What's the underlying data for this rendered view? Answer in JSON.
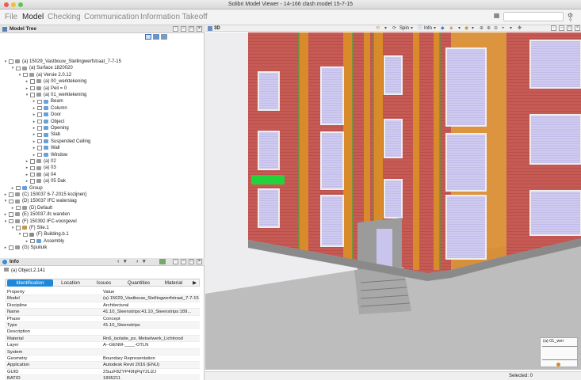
{
  "window": {
    "title": "Solibri Model Viewer - 14-166 clash model 15-7-15"
  },
  "menu": [
    "File",
    "Model",
    "Checking",
    "Communication",
    "Information Takeoff"
  ],
  "menu_active": "Model",
  "model_tree": {
    "title": "Model Tree",
    "rows": [
      {
        "label": "(a) 15029_Vastbouw_Stellingwerfstraat_7-7-15",
        "indent": 0,
        "tw": "▾",
        "icon": "box"
      },
      {
        "label": "(a) Surface 1820020",
        "indent": 1,
        "tw": "▾",
        "icon": "box"
      },
      {
        "label": "(a) Versie 2.0.12",
        "indent": 2,
        "tw": "▾",
        "icon": "box"
      },
      {
        "label": "(a) 00_werktekening",
        "indent": 3,
        "tw": "▸",
        "icon": "box"
      },
      {
        "label": "(a) Peil = 0",
        "indent": 3,
        "tw": "▸",
        "icon": "box"
      },
      {
        "label": "(a) 01_werktekening",
        "indent": 3,
        "tw": "▾",
        "icon": "box"
      },
      {
        "label": "Beam",
        "indent": 4,
        "tw": "▸",
        "icon": "folder"
      },
      {
        "label": "Column",
        "indent": 4,
        "tw": "▸",
        "icon": "folder"
      },
      {
        "label": "Door",
        "indent": 4,
        "tw": "▸",
        "icon": "folder"
      },
      {
        "label": "Object",
        "indent": 4,
        "tw": "▸",
        "icon": "folder"
      },
      {
        "label": "Opening",
        "indent": 4,
        "tw": "▸",
        "icon": "folder"
      },
      {
        "label": "Slab",
        "indent": 4,
        "tw": "▸",
        "icon": "folder"
      },
      {
        "label": "Suspended Ceiling",
        "indent": 4,
        "tw": "▸",
        "icon": "folder"
      },
      {
        "label": "Wall",
        "indent": 4,
        "tw": "▸",
        "icon": "folder"
      },
      {
        "label": "Window",
        "indent": 4,
        "tw": "▸",
        "icon": "folder"
      },
      {
        "label": "(a) 02",
        "indent": 3,
        "tw": "▸",
        "icon": "box"
      },
      {
        "label": "(a) 03",
        "indent": 3,
        "tw": "▸",
        "icon": "box"
      },
      {
        "label": "(a) 04",
        "indent": 3,
        "tw": "▸",
        "icon": "box"
      },
      {
        "label": "(a) 05 Dak",
        "indent": 3,
        "tw": "▸",
        "icon": "box"
      },
      {
        "label": "Group",
        "indent": 1,
        "tw": "▸",
        "icon": "folder"
      },
      {
        "label": "(C) 150037 6-7-2015 kozijnen]",
        "indent": 0,
        "tw": "▸",
        "icon": "box"
      },
      {
        "label": "(D) 150037 IFC waterslag",
        "indent": 0,
        "tw": "▾",
        "icon": "box"
      },
      {
        "label": "(D) Default",
        "indent": 1,
        "tw": "▸",
        "icon": "box"
      },
      {
        "label": "(E) 150037.ifc wanden",
        "indent": 0,
        "tw": "▸",
        "icon": "box"
      },
      {
        "label": "(F) 150392 IFC-voorgevel",
        "indent": 0,
        "tw": "▾",
        "icon": "box"
      },
      {
        "label": "(F) Site.1",
        "indent": 1,
        "tw": "▾",
        "icon": "site"
      },
      {
        "label": "(F) Building.b.1",
        "indent": 2,
        "tw": "▾",
        "icon": "bld"
      },
      {
        "label": "Assembly",
        "indent": 3,
        "tw": "▸",
        "icon": "folder"
      },
      {
        "label": "(G) Spuiluik",
        "indent": 0,
        "tw": "▸",
        "icon": "box"
      }
    ]
  },
  "info": {
    "title": "Info",
    "object": "(a) Object.2.141",
    "tabs": [
      "Identification",
      "Location",
      "Issues",
      "Quantities",
      "Material"
    ],
    "selected_tab": "Identification",
    "header": {
      "k": "Property",
      "v": "Value"
    },
    "rows": [
      {
        "k": "Model",
        "v": "(a) 15029_Vastbouw_Stellingwerfstraat_7-7-15"
      },
      {
        "k": "Discipline",
        "v": "Architectural"
      },
      {
        "k": "Name",
        "v": "41.10_Steenstrips:41.10_Steenstrips:189..."
      },
      {
        "k": "Phase",
        "v": "Concept"
      },
      {
        "k": "Type",
        "v": "41.10_Steenstrips"
      },
      {
        "k": "Description",
        "v": ""
      },
      {
        "k": "Material",
        "v": "Rn6_isolatie_ps, Metselwerk_Lichtrood"
      },
      {
        "k": "Layer",
        "v": "A--GENM-____-OTLN"
      },
      {
        "k": "System",
        "v": ""
      },
      {
        "k": "Geometry",
        "v": "Boundary Representation"
      },
      {
        "k": "Application",
        "v": "Autodesk Revit 2016 (ENU)"
      },
      {
        "k": "GUID",
        "v": "2SuzF8ZYP49hjPqY2Li2J"
      },
      {
        "k": "BATID",
        "v": "1895211"
      }
    ]
  },
  "view": {
    "title": "3D",
    "toolbar": [
      "Spin",
      "Info"
    ],
    "minimap_label": "(a) 01_wer",
    "status": "Selected: 0"
  },
  "colors": {
    "selected_tab": "#1e88d8",
    "brick": "#c0504a",
    "insulation": "#d98a2a",
    "glass": "#c8c4ec",
    "highlight": "#22d43a"
  }
}
